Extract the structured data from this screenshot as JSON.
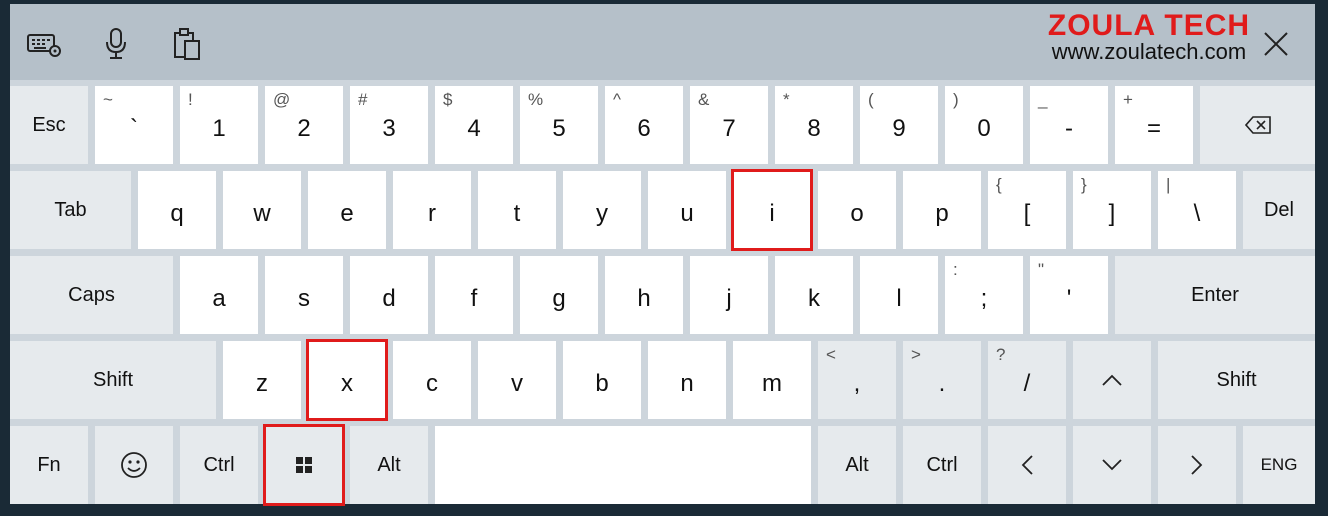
{
  "branding": {
    "title": "ZOULA TECH",
    "url": "www.zoulatech.com"
  },
  "toolbar": {
    "icons": [
      "keyboard-settings-icon",
      "microphone-icon",
      "clipboard-icon"
    ],
    "close_icon": "close-icon"
  },
  "highlight_color": "#e01b1b",
  "rows": {
    "row1": {
      "esc": "Esc",
      "keys": [
        {
          "shift": "~",
          "main": "`"
        },
        {
          "shift": "!",
          "main": "1"
        },
        {
          "shift": "@",
          "main": "2"
        },
        {
          "shift": "#",
          "main": "3"
        },
        {
          "shift": "$",
          "main": "4"
        },
        {
          "shift": "%",
          "main": "5"
        },
        {
          "shift": "^",
          "main": "6"
        },
        {
          "shift": "&",
          "main": "7"
        },
        {
          "shift": "*",
          "main": "8"
        },
        {
          "shift": "(",
          "main": "9"
        },
        {
          "shift": ")",
          "main": "0"
        },
        {
          "shift": "_",
          "main": "-"
        },
        {
          "shift": "+",
          "main": "="
        }
      ],
      "backspace_icon": "backspace-icon"
    },
    "row2": {
      "tab": "Tab",
      "keys": [
        {
          "shift": "",
          "main": "q"
        },
        {
          "shift": "",
          "main": "w"
        },
        {
          "shift": "",
          "main": "e"
        },
        {
          "shift": "",
          "main": "r"
        },
        {
          "shift": "",
          "main": "t"
        },
        {
          "shift": "",
          "main": "y"
        },
        {
          "shift": "",
          "main": "u"
        },
        {
          "shift": "",
          "main": "i"
        },
        {
          "shift": "",
          "main": "o"
        },
        {
          "shift": "",
          "main": "p"
        },
        {
          "shift": "{",
          "main": "["
        },
        {
          "shift": "}",
          "main": "]"
        },
        {
          "shift": "|",
          "main": "\\"
        }
      ],
      "del": "Del"
    },
    "row3": {
      "caps": "Caps",
      "keys": [
        {
          "shift": "",
          "main": "a"
        },
        {
          "shift": "",
          "main": "s"
        },
        {
          "shift": "",
          "main": "d"
        },
        {
          "shift": "",
          "main": "f"
        },
        {
          "shift": "",
          "main": "g"
        },
        {
          "shift": "",
          "main": "h"
        },
        {
          "shift": "",
          "main": "j"
        },
        {
          "shift": "",
          "main": "k"
        },
        {
          "shift": "",
          "main": "l"
        },
        {
          "shift": ":",
          "main": ";"
        },
        {
          "shift": "\"",
          "main": "'"
        }
      ],
      "enter": "Enter"
    },
    "row4": {
      "shift_left": "Shift",
      "keys": [
        {
          "shift": "",
          "main": "z"
        },
        {
          "shift": "",
          "main": "x"
        },
        {
          "shift": "",
          "main": "c"
        },
        {
          "shift": "",
          "main": "v"
        },
        {
          "shift": "",
          "main": "b"
        },
        {
          "shift": "",
          "main": "n"
        },
        {
          "shift": "",
          "main": "m"
        },
        {
          "shift": "<",
          "main": ","
        },
        {
          "shift": ">",
          "main": "."
        },
        {
          "shift": "?",
          "main": "/"
        }
      ],
      "up_icon": "chevron-up-icon",
      "shift_right": "Shift"
    },
    "row5": {
      "fn": "Fn",
      "emoji_icon": "emoji-icon",
      "ctrl_left": "Ctrl",
      "windows_icon": "windows-icon",
      "alt_left": "Alt",
      "alt_right": "Alt",
      "ctrl_right": "Ctrl",
      "left_icon": "chevron-left-icon",
      "down_icon": "chevron-down-icon",
      "right_icon": "chevron-right-icon",
      "lang": "ENG"
    }
  }
}
